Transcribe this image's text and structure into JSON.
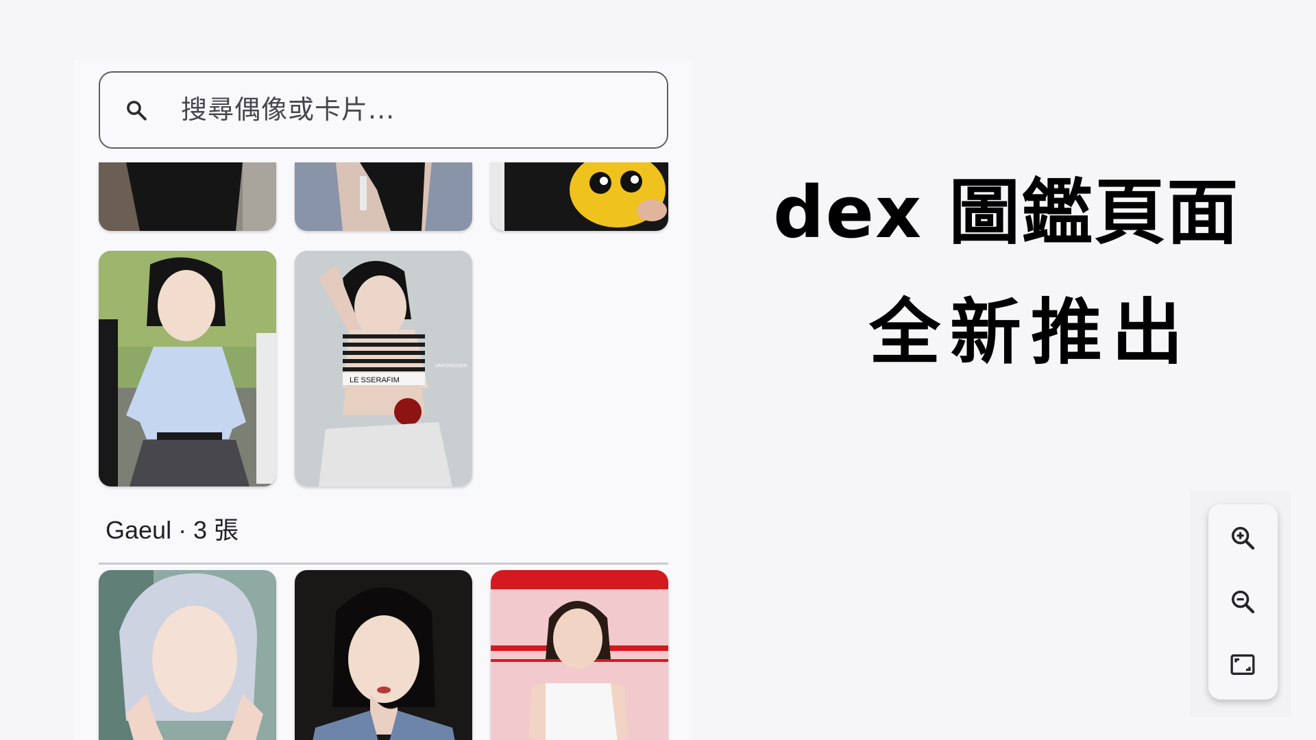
{
  "search": {
    "placeholder": "搜尋偶像或卡片..."
  },
  "section": {
    "label": "Gaeul · 3 張"
  },
  "headline": {
    "line1": "dex 圖鑑頁面",
    "line2": "全新推出"
  },
  "toolbar": {
    "zoom_in_icon": "zoom-in-icon",
    "zoom_out_icon": "zoom-out-icon",
    "fit_icon": "fit-screen-icon"
  },
  "photo_texts": {
    "top_band": "LE SSERAFIM",
    "side_text": "UNFORGIVEN"
  },
  "colors": {
    "background": "#f6f6f8",
    "panel": "#f9f9fc",
    "outline": "#5c5c66",
    "text": "#1e1e24"
  }
}
